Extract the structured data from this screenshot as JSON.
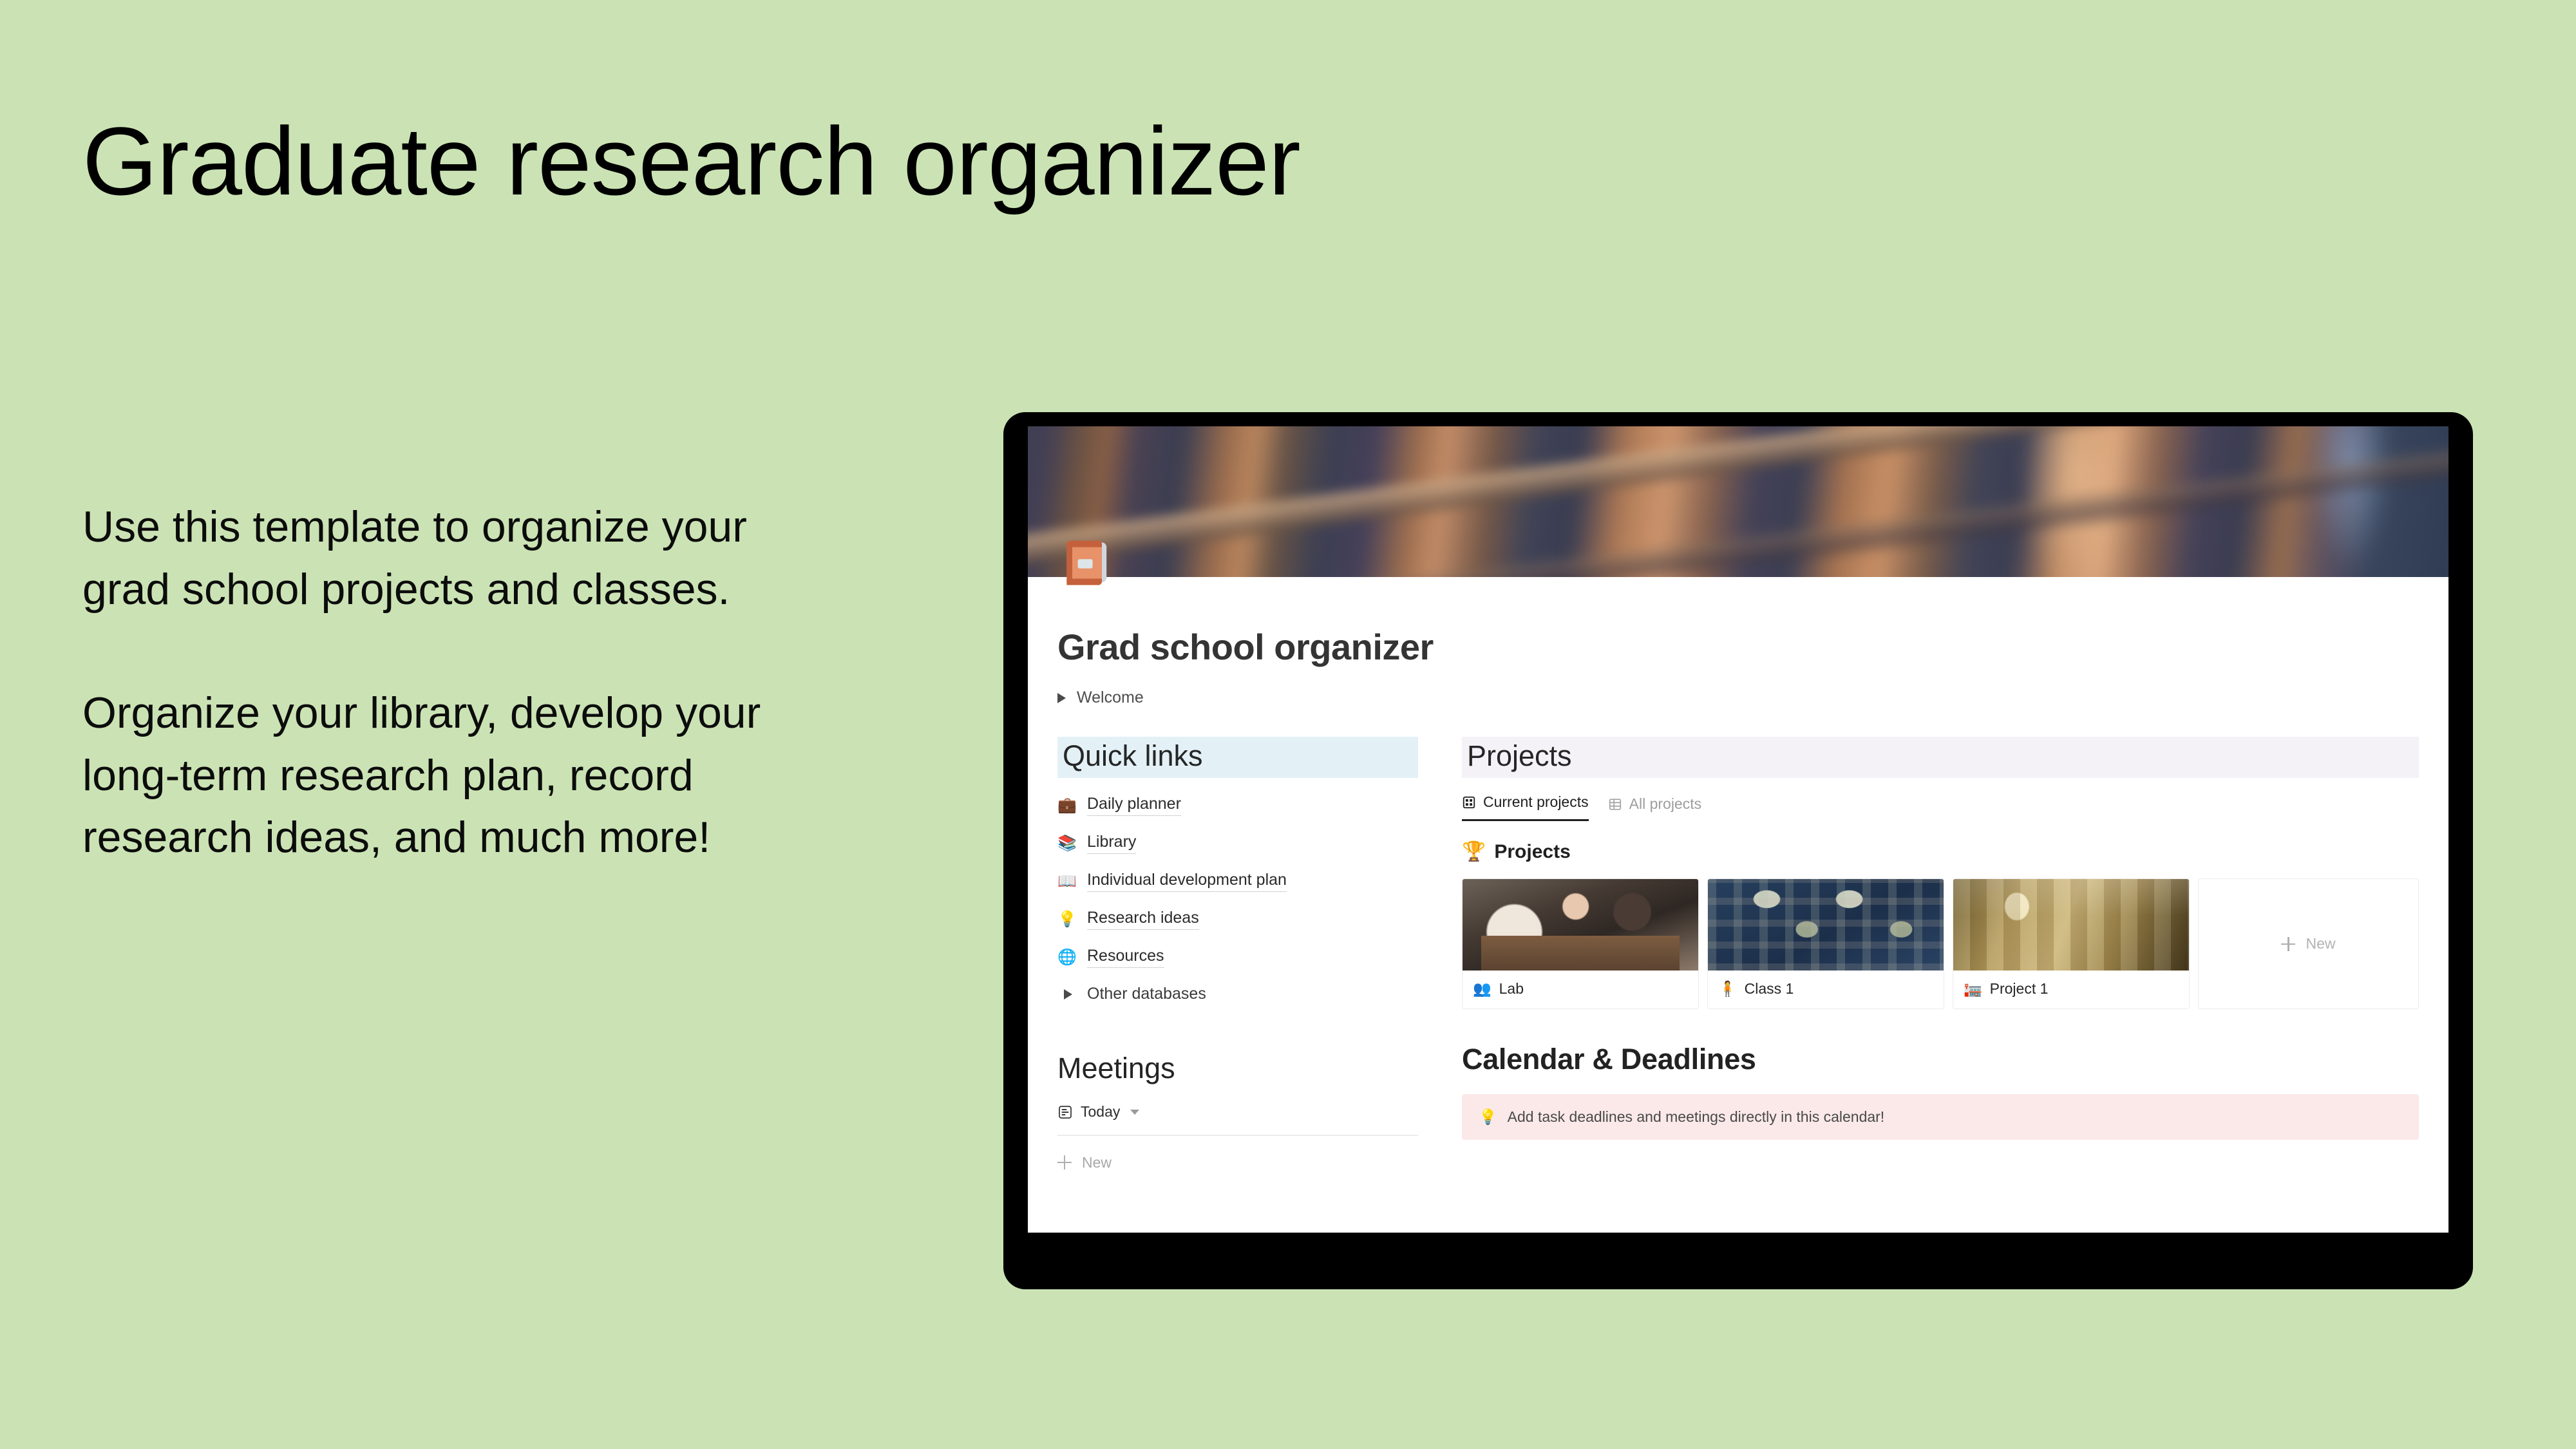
{
  "slide": {
    "title": "Graduate research organizer",
    "paragraphs": [
      "Use this template to organize your grad school projects and classes.",
      "Organize your library, develop your long-term research plan, record research ideas, and much more!"
    ],
    "background_color": "#cbe3b4"
  },
  "app": {
    "page_icon": "closed-book-emoji",
    "page_title": "Grad school organizer",
    "toggle": {
      "label": "Welcome",
      "icon": "collapsed-triangle-icon"
    },
    "cover": {
      "description": "blurred library bookshelf photo"
    },
    "quick_links": {
      "heading": "Quick links",
      "heading_highlight": "#e3f1f7",
      "items": [
        {
          "label": "Daily planner",
          "icon": "briefcase-emoji",
          "glyph": "💼"
        },
        {
          "label": "Library",
          "icon": "books-emoji",
          "glyph": "📚"
        },
        {
          "label": "Individual development plan",
          "icon": "open-book-emoji",
          "glyph": "📖"
        },
        {
          "label": "Research ideas",
          "icon": "light-bulb-emoji",
          "glyph": "💡"
        },
        {
          "label": "Resources",
          "icon": "globe-emoji",
          "glyph": "🌐"
        }
      ],
      "other": {
        "label": "Other databases",
        "icon": "collapsed-triangle-icon"
      }
    },
    "meetings": {
      "heading": "Meetings",
      "view": {
        "label": "Today",
        "icon": "list-view-icon",
        "chevron": "chevron-down-icon"
      },
      "new_label": "New"
    },
    "projects": {
      "heading": "Projects",
      "heading_highlight": "#f4f2f7",
      "tabs": [
        {
          "label": "Current projects",
          "icon": "gallery-view-icon",
          "active": true
        },
        {
          "label": "All projects",
          "icon": "table-view-icon",
          "active": false
        }
      ],
      "group": {
        "label": "Projects",
        "icon": "trophy-emoji",
        "glyph": "🏆"
      },
      "cards": [
        {
          "label": "Lab",
          "icon": "busts-in-silhouette-emoji",
          "glyph": "👥",
          "image": "students-with-laptop-photo"
        },
        {
          "label": "Class 1",
          "icon": "standing-person-emoji",
          "glyph": "🧍",
          "image": "blue-william-morris-pattern"
        },
        {
          "label": "Project 1",
          "icon": "japanese-post-office-emoji",
          "glyph": "🏣",
          "image": "golden-cathedral-interior-photo"
        }
      ],
      "new_card_label": "New"
    },
    "calendar": {
      "heading": "Calendar & Deadlines",
      "callout": {
        "text": "Add task deadlines and meetings directly in this calendar!",
        "icon": "light-bulb-emoji",
        "glyph": "💡",
        "background": "#fbe9e9"
      }
    }
  }
}
